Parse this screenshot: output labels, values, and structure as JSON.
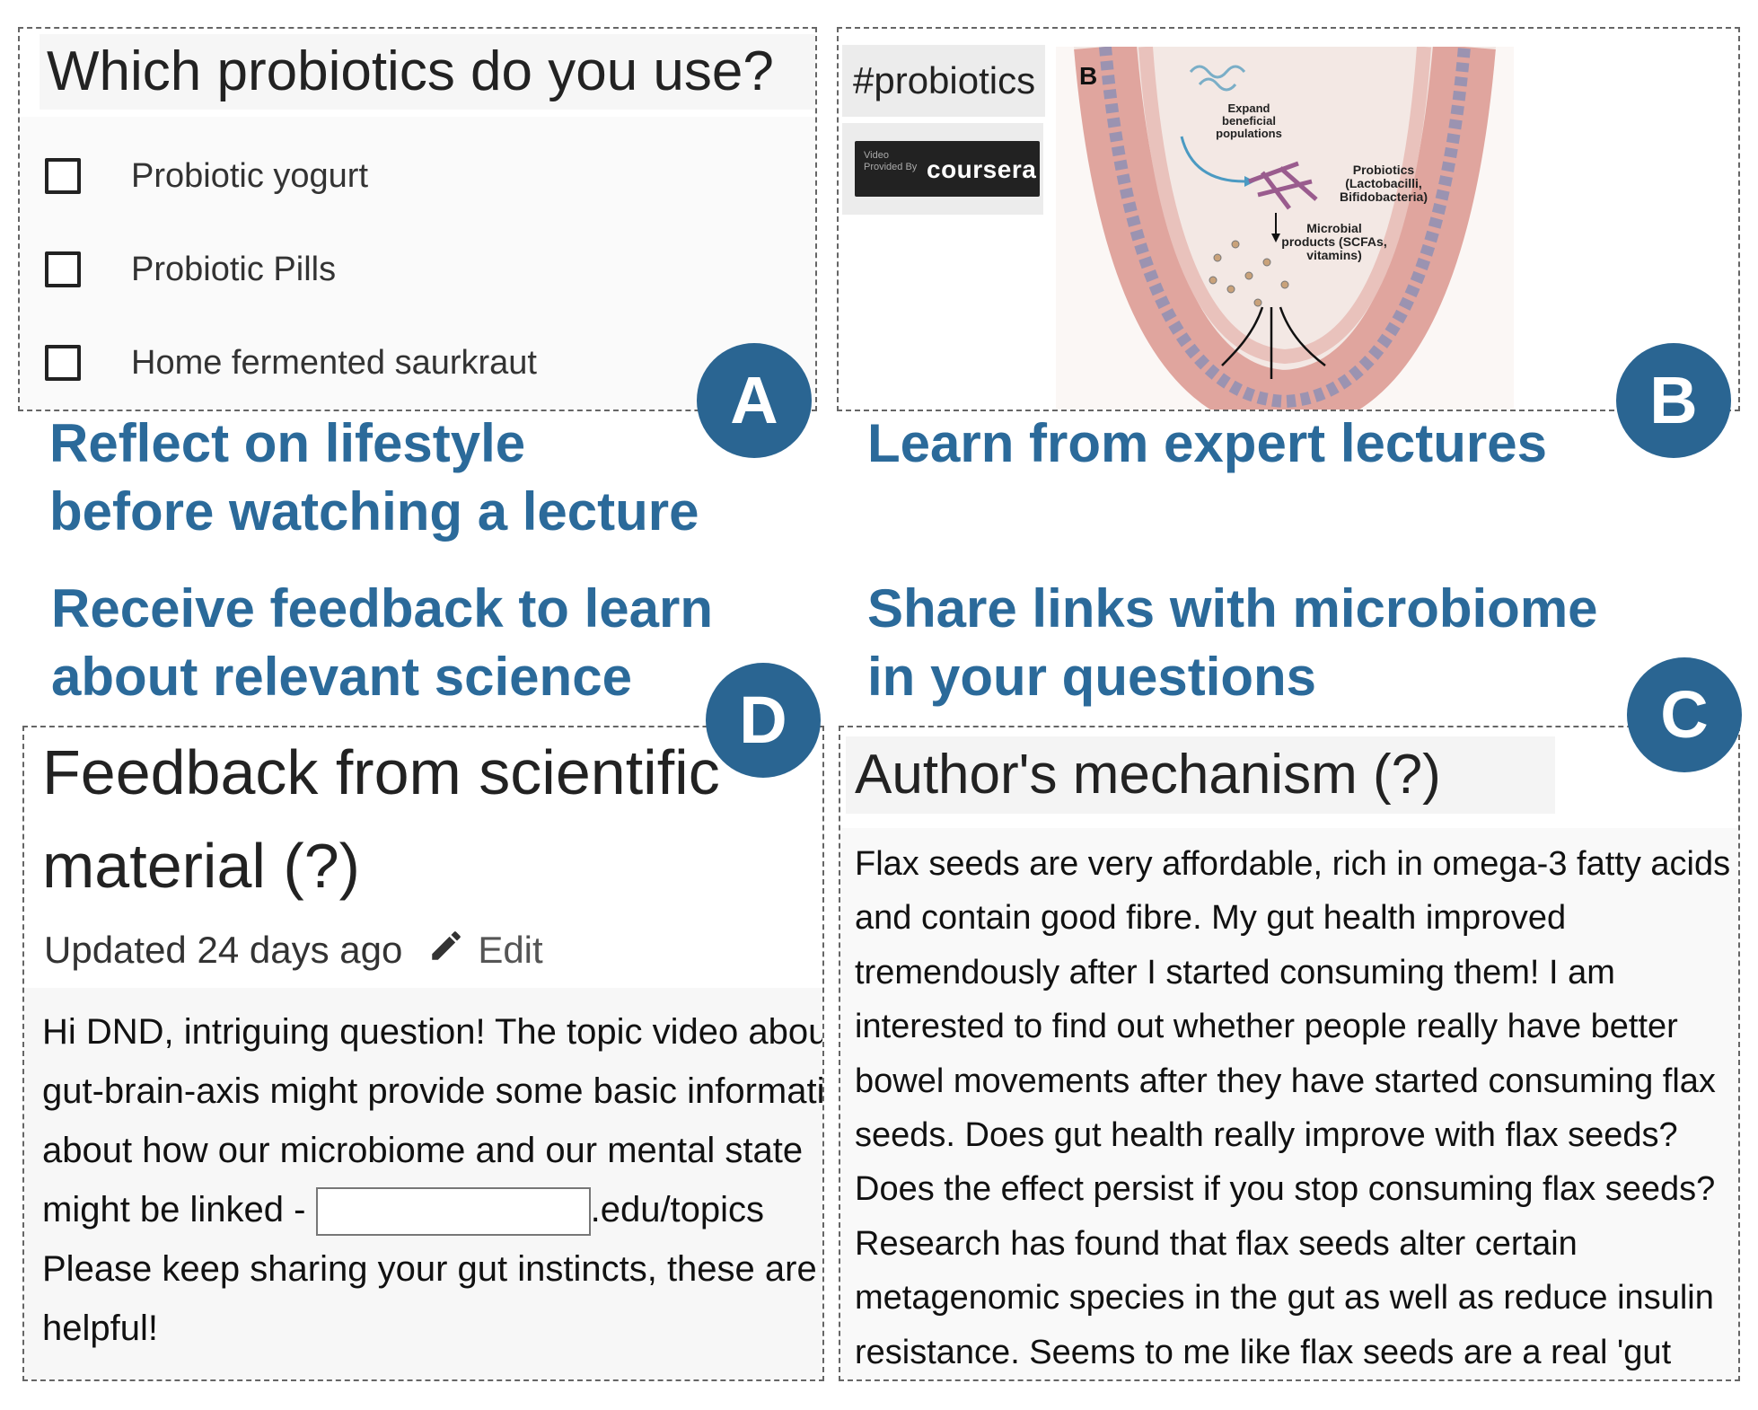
{
  "panel_a": {
    "question": "Which probiotics do you use?",
    "options": [
      "Probiotic yogurt",
      "Probiotic Pills",
      "Home fermented saurkraut"
    ]
  },
  "panel_b": {
    "hashtag": "#probiotics",
    "provider_prefix": "Video Provided By",
    "provider_name": "coursera",
    "figure": {
      "panel_letter": "B",
      "label_expand": "Expand beneficial populations",
      "label_probiotics": "Probiotics (Lactobacilli, Bifidobacteria)",
      "label_products": "Microbial products (SCFAs, vitamins)"
    }
  },
  "badges": {
    "a": "A",
    "b": "B",
    "c": "C",
    "d": "D"
  },
  "captions": {
    "a_line1": "Reflect on lifestyle",
    "a_line2": "before watching a lecture",
    "b": "Learn from expert lectures",
    "d_line1": "Receive feedback to learn",
    "d_line2": "about relevant science",
    "c_line1": "Share links with microbiome",
    "c_line2": "in your questions"
  },
  "panel_d": {
    "title": "Feedback from scientific material (?)",
    "updated": "Updated 24 days ago",
    "edit_label": "Edit",
    "body_before": "Hi DND, intriguing question! The topic video about gut-brain-axis might provide some basic information about how our microbiome and our mental state might be linked - ",
    "body_after": ".edu/topics Please keep sharing your gut instincts, these are helpful!"
  },
  "panel_c": {
    "title": "Author's mechanism (?)",
    "body": "Flax seeds are very affordable, rich in omega-3 fatty acids and contain good fibre.  My gut health improved tremendously after I started consuming them! I am interested to find out whether people really have better bowel movements after they have started consuming flax seeds. Does gut health really improve with flax seeds? Does the effect persist if you stop consuming flax seeds? Research has found that flax seeds alter certain metagenomic species in the gut as well as reduce insulin resistance. Seems to me like flax seeds are a real 'gut"
  },
  "colors": {
    "accent": "#2b6a9a",
    "badge": "#2a6592",
    "border": "#666666"
  }
}
